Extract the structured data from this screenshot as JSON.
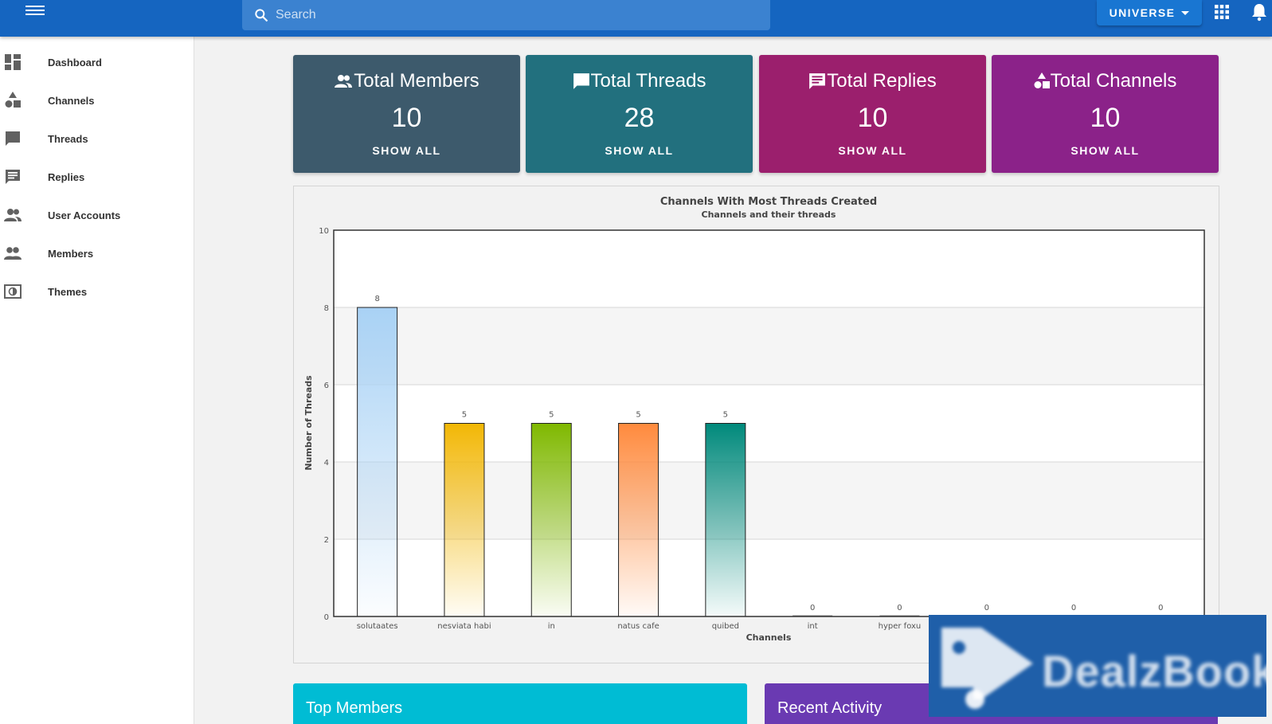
{
  "topbar": {
    "search_placeholder": "Search",
    "universe_label": "UNIVERSE"
  },
  "sidebar": {
    "items": [
      {
        "label": "Dashboard",
        "icon": "dashboard-icon"
      },
      {
        "label": "Channels",
        "icon": "category-icon"
      },
      {
        "label": "Threads",
        "icon": "chat-bubble-icon"
      },
      {
        "label": "Replies",
        "icon": "message-icon"
      },
      {
        "label": "User Accounts",
        "icon": "people-icon"
      },
      {
        "label": "Members",
        "icon": "group-icon"
      },
      {
        "label": "Themes",
        "icon": "brightness-icon"
      }
    ]
  },
  "stats": [
    {
      "title": "Total Members",
      "value": "10",
      "button": "SHOW ALL",
      "color": "#3d5a6c",
      "icon": "people-icon"
    },
    {
      "title": "Total Threads",
      "value": "28",
      "button": "SHOW ALL",
      "color": "#22707e",
      "icon": "chat-bubble-icon"
    },
    {
      "title": "Total Replies",
      "value": "10",
      "button": "SHOW ALL",
      "color": "#9b1f6d",
      "icon": "message-icon"
    },
    {
      "title": "Total Channels",
      "value": "10",
      "button": "SHOW ALL",
      "color": "#8b2289",
      "icon": "category-icon"
    }
  ],
  "chart_data": {
    "type": "bar",
    "title": "Channels With Most Threads Created",
    "subtitle": "Channels and their threads",
    "xlabel": "Channels",
    "ylabel": "Number of Threads",
    "ylim": [
      0,
      10
    ],
    "yticks": [
      0,
      2,
      4,
      6,
      8,
      10
    ],
    "grid": true,
    "categories": [
      "solutaates",
      "nesviata habi",
      "in",
      "natus cafe",
      "quibed",
      "int",
      "hyper foxu",
      "",
      "",
      ""
    ],
    "values": [
      8,
      5,
      5,
      5,
      5,
      0,
      0,
      0,
      0,
      0
    ],
    "colors": [
      "#a9d2f5",
      "#f2b705",
      "#7fb800",
      "#ff8a3d",
      "#00897b",
      "#999999",
      "#999999",
      "#999999",
      "#999999",
      "#999999"
    ]
  },
  "bottom_cards": [
    {
      "title": "Top Members",
      "color": "#00bcd4"
    },
    {
      "title": "Recent Activity",
      "color": "#6a3ab2"
    }
  ],
  "watermark": {
    "text": "DealzBook"
  }
}
